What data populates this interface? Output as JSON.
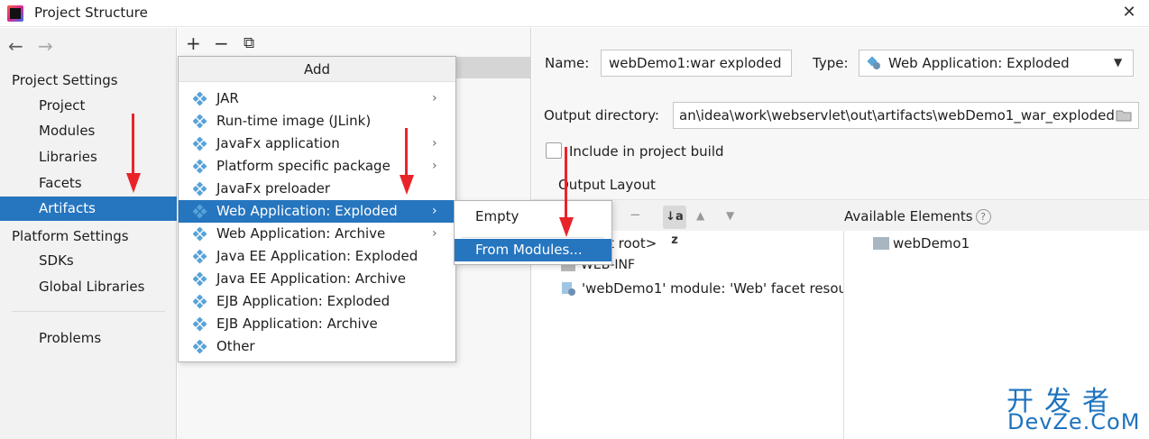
{
  "window": {
    "title": "Project Structure",
    "close": "✕"
  },
  "nav": {
    "back": "←",
    "forward": "→",
    "project_settings": "Project Settings",
    "project_items": [
      "Project",
      "Modules",
      "Libraries",
      "Facets",
      "Artifacts"
    ],
    "platform_settings": "Platform Settings",
    "platform_items": [
      "SDKs",
      "Global Libraries"
    ],
    "problems": "Problems",
    "selected": "Artifacts"
  },
  "toolbar": {
    "add": "+",
    "remove": "−",
    "copy": "⧉"
  },
  "add_menu": {
    "header": "Add",
    "items": [
      {
        "label": "JAR",
        "submenu": true
      },
      {
        "label": "Run-time image (JLink)",
        "submenu": false
      },
      {
        "label": "JavaFx application",
        "submenu": true
      },
      {
        "label": "Platform specific package",
        "submenu": true
      },
      {
        "label": "JavaFx preloader",
        "submenu": false
      },
      {
        "label": "Web Application: Exploded",
        "submenu": true
      },
      {
        "label": "Web Application: Archive",
        "submenu": true
      },
      {
        "label": "Java EE Application: Exploded",
        "submenu": false
      },
      {
        "label": "Java EE Application: Archive",
        "submenu": false
      },
      {
        "label": "EJB Application: Exploded",
        "submenu": false
      },
      {
        "label": "EJB Application: Archive",
        "submenu": false
      },
      {
        "label": "Other",
        "submenu": false
      }
    ],
    "highlighted": "Web Application: Exploded",
    "chevron": "›"
  },
  "sub_menu": {
    "items": [
      "Empty",
      "From Modules..."
    ],
    "highlighted": "From Modules..."
  },
  "artifact": {
    "name_label": "Name:",
    "name_value": "webDemo1:war exploded",
    "type_label": "Type:",
    "type_value": "Web Application: Exploded",
    "output_label": "Output directory:",
    "output_value": "an\\idea\\work\\webservlet\\out\\artifacts\\webDemo1_war_exploded",
    "include_label": "Include in project build",
    "output_layout": "Output Layout",
    "available_elements": "Available Elements",
    "help": "?",
    "tree": [
      "t root>",
      "WEB-INF",
      "'webDemo1' module: 'Web' facet resour"
    ],
    "available": [
      "webDemo1"
    ],
    "sort_icon": "↓a z"
  },
  "watermark": {
    "cn": "开发者",
    "en": "DevZe.CoM"
  },
  "colors": {
    "selection": "#2675bf",
    "arrow": "#e8242a",
    "watermark": "#1e73be"
  }
}
